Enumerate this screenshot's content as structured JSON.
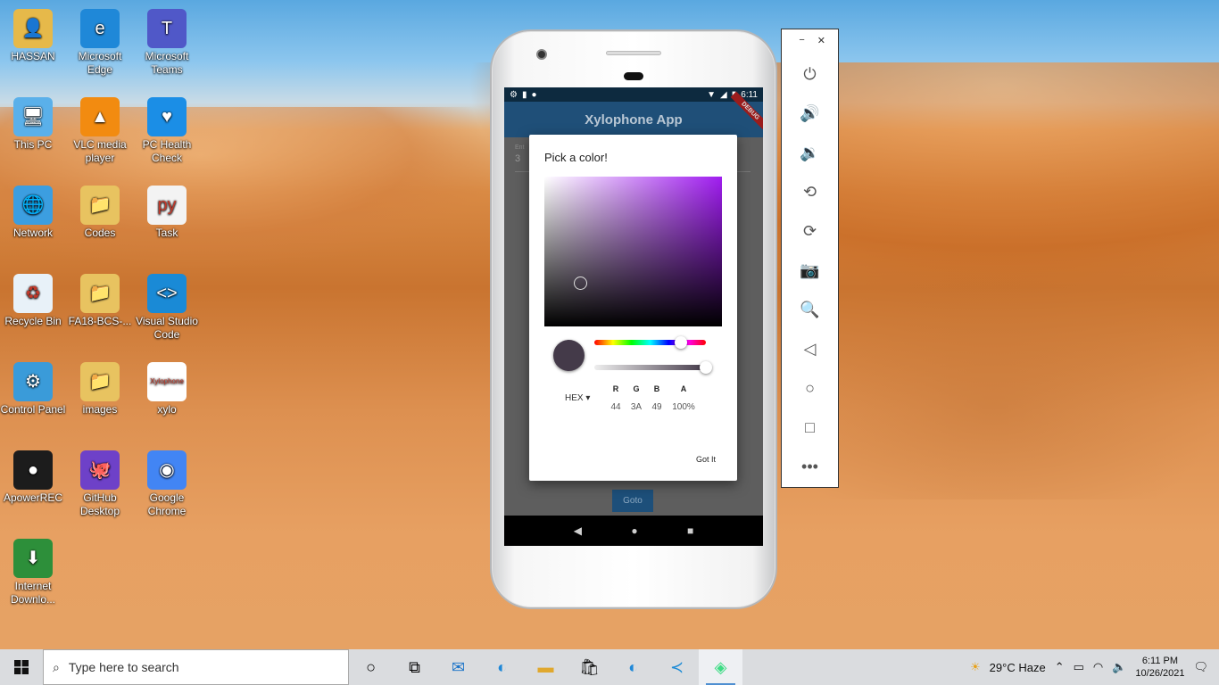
{
  "desktop": {
    "icons": [
      {
        "label": "HASSAN",
        "glyph": "👤",
        "color": "#e6b94a"
      },
      {
        "label": "Microsoft Edge",
        "glyph": "e",
        "color": "#1f88d8"
      },
      {
        "label": "Microsoft Teams",
        "glyph": "T",
        "color": "#5058c8"
      },
      {
        "label": "This PC",
        "glyph": "🖥",
        "color": "#5ab0ea"
      },
      {
        "label": "VLC media player",
        "glyph": "▲",
        "color": "#f28b10"
      },
      {
        "label": "PC Health Check",
        "glyph": "♥",
        "color": "#1b8ee6"
      },
      {
        "label": "Network",
        "glyph": "🌐",
        "color": "#3c9ee0"
      },
      {
        "label": "Codes",
        "glyph": "📁",
        "color": "#e8c360"
      },
      {
        "label": "Task",
        "glyph": "py",
        "color": "#f3f3f3"
      },
      {
        "label": "Recycle Bin",
        "glyph": "♻",
        "color": "#e8f1f8"
      },
      {
        "label": "FA18-BCS-...",
        "glyph": "📁",
        "color": "#e8c360"
      },
      {
        "label": "Visual Studio Code",
        "glyph": "<>",
        "color": "#1a8ad6"
      },
      {
        "label": "Control Panel",
        "glyph": "⚙",
        "color": "#3a9bd9"
      },
      {
        "label": "images",
        "glyph": "📁",
        "color": "#e8c360"
      },
      {
        "label": "xylo",
        "glyph": "Xylophone",
        "color": "#ffffff"
      },
      {
        "label": "ApowerREC",
        "glyph": "●",
        "color": "#1c1c1c"
      },
      {
        "label": "GitHub Desktop",
        "glyph": "🐙",
        "color": "#6e41c8"
      },
      {
        "label": "Google Chrome",
        "glyph": "◉",
        "color": "#4285f4"
      },
      {
        "label": "Internet Downlo...",
        "glyph": "⬇",
        "color": "#2d8f3a"
      }
    ]
  },
  "phone": {
    "status_time": "6:11",
    "app_title": "Xylophone App",
    "debug_banner": "DEBUG",
    "field_label": "Ent",
    "field_value": "3",
    "goto_label": "Goto"
  },
  "dialog": {
    "title": "Pick a color!",
    "format_label": "HEX",
    "channels": [
      {
        "name": "R",
        "value": "44"
      },
      {
        "name": "G",
        "value": "3A"
      },
      {
        "name": "B",
        "value": "49"
      },
      {
        "name": "A",
        "value": "100%"
      }
    ],
    "confirm_label": "Got It",
    "hue_fraction": 0.78,
    "alpha_fraction": 1.0,
    "current_color": "#443a49"
  },
  "emulator_toolbar": {
    "minimize": "−",
    "close": "✕",
    "buttons": [
      {
        "name": "power-icon",
        "glyph": "⏻"
      },
      {
        "name": "volume-up-icon",
        "glyph": "🔊"
      },
      {
        "name": "volume-down-icon",
        "glyph": "🔉"
      },
      {
        "name": "rotate-left-icon",
        "glyph": "⟲"
      },
      {
        "name": "rotate-right-icon",
        "glyph": "⟳"
      },
      {
        "name": "camera-icon",
        "glyph": "📷"
      },
      {
        "name": "zoom-icon",
        "glyph": "🔍"
      },
      {
        "name": "back-icon",
        "glyph": "◁"
      },
      {
        "name": "home-icon",
        "glyph": "○"
      },
      {
        "name": "overview-icon",
        "glyph": "□"
      },
      {
        "name": "more-icon",
        "glyph": "•••"
      }
    ]
  },
  "taskbar": {
    "search_placeholder": "Type here to search",
    "weather": "29°C  Haze",
    "time": "6:11 PM",
    "date": "10/26/2021"
  }
}
